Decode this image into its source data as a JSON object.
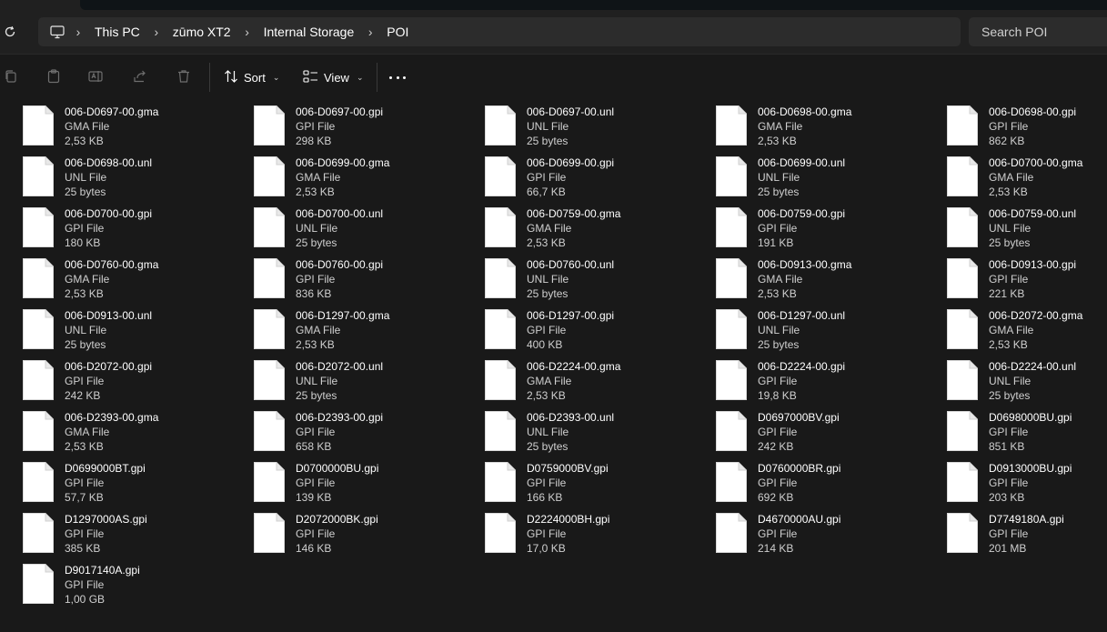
{
  "breadcrumb": [
    "This PC",
    "zūmo XT2",
    "Internal Storage",
    "POI"
  ],
  "search": {
    "placeholder": "Search POI"
  },
  "toolbar": {
    "sort_label": "Sort",
    "view_label": "View"
  },
  "files": [
    {
      "name": "006-D0697-00.gma",
      "type": "GMA File",
      "size": "2,53 KB"
    },
    {
      "name": "006-D0697-00.gpi",
      "type": "GPI File",
      "size": "298 KB"
    },
    {
      "name": "006-D0697-00.unl",
      "type": "UNL File",
      "size": "25 bytes"
    },
    {
      "name": "006-D0698-00.gma",
      "type": "GMA File",
      "size": "2,53 KB"
    },
    {
      "name": "006-D0698-00.gpi",
      "type": "GPI File",
      "size": "862 KB"
    },
    {
      "name": "006-D0698-00.unl",
      "type": "UNL File",
      "size": "25 bytes"
    },
    {
      "name": "006-D0699-00.gma",
      "type": "GMA File",
      "size": "2,53 KB"
    },
    {
      "name": "006-D0699-00.gpi",
      "type": "GPI File",
      "size": "66,7 KB"
    },
    {
      "name": "006-D0699-00.unl",
      "type": "UNL File",
      "size": "25 bytes"
    },
    {
      "name": "006-D0700-00.gma",
      "type": "GMA File",
      "size": "2,53 KB"
    },
    {
      "name": "006-D0700-00.gpi",
      "type": "GPI File",
      "size": "180 KB"
    },
    {
      "name": "006-D0700-00.unl",
      "type": "UNL File",
      "size": "25 bytes"
    },
    {
      "name": "006-D0759-00.gma",
      "type": "GMA File",
      "size": "2,53 KB"
    },
    {
      "name": "006-D0759-00.gpi",
      "type": "GPI File",
      "size": "191 KB"
    },
    {
      "name": "006-D0759-00.unl",
      "type": "UNL File",
      "size": "25 bytes"
    },
    {
      "name": "006-D0760-00.gma",
      "type": "GMA File",
      "size": "2,53 KB"
    },
    {
      "name": "006-D0760-00.gpi",
      "type": "GPI File",
      "size": "836 KB"
    },
    {
      "name": "006-D0760-00.unl",
      "type": "UNL File",
      "size": "25 bytes"
    },
    {
      "name": "006-D0913-00.gma",
      "type": "GMA File",
      "size": "2,53 KB"
    },
    {
      "name": "006-D0913-00.gpi",
      "type": "GPI File",
      "size": "221 KB"
    },
    {
      "name": "006-D0913-00.unl",
      "type": "UNL File",
      "size": "25 bytes"
    },
    {
      "name": "006-D1297-00.gma",
      "type": "GMA File",
      "size": "2,53 KB"
    },
    {
      "name": "006-D1297-00.gpi",
      "type": "GPI File",
      "size": "400 KB"
    },
    {
      "name": "006-D1297-00.unl",
      "type": "UNL File",
      "size": "25 bytes"
    },
    {
      "name": "006-D2072-00.gma",
      "type": "GMA File",
      "size": "2,53 KB"
    },
    {
      "name": "006-D2072-00.gpi",
      "type": "GPI File",
      "size": "242 KB"
    },
    {
      "name": "006-D2072-00.unl",
      "type": "UNL File",
      "size": "25 bytes"
    },
    {
      "name": "006-D2224-00.gma",
      "type": "GMA File",
      "size": "2,53 KB"
    },
    {
      "name": "006-D2224-00.gpi",
      "type": "GPI File",
      "size": "19,8 KB"
    },
    {
      "name": "006-D2224-00.unl",
      "type": "UNL File",
      "size": "25 bytes"
    },
    {
      "name": "006-D2393-00.gma",
      "type": "GMA File",
      "size": "2,53 KB"
    },
    {
      "name": "006-D2393-00.gpi",
      "type": "GPI File",
      "size": "658 KB"
    },
    {
      "name": "006-D2393-00.unl",
      "type": "UNL File",
      "size": "25 bytes"
    },
    {
      "name": "D0697000BV.gpi",
      "type": "GPI File",
      "size": "242 KB"
    },
    {
      "name": "D0698000BU.gpi",
      "type": "GPI File",
      "size": "851 KB"
    },
    {
      "name": "D0699000BT.gpi",
      "type": "GPI File",
      "size": "57,7 KB"
    },
    {
      "name": "D0700000BU.gpi",
      "type": "GPI File",
      "size": "139 KB"
    },
    {
      "name": "D0759000BV.gpi",
      "type": "GPI File",
      "size": "166 KB"
    },
    {
      "name": "D0760000BR.gpi",
      "type": "GPI File",
      "size": "692 KB"
    },
    {
      "name": "D0913000BU.gpi",
      "type": "GPI File",
      "size": "203 KB"
    },
    {
      "name": "D1297000AS.gpi",
      "type": "GPI File",
      "size": "385 KB"
    },
    {
      "name": "D2072000BK.gpi",
      "type": "GPI File",
      "size": "146 KB"
    },
    {
      "name": "D2224000BH.gpi",
      "type": "GPI File",
      "size": "17,0 KB"
    },
    {
      "name": "D4670000AU.gpi",
      "type": "GPI File",
      "size": "214 KB"
    },
    {
      "name": "D7749180A.gpi",
      "type": "GPI File",
      "size": "201 MB"
    },
    {
      "name": "D9017140A.gpi",
      "type": "GPI File",
      "size": "1,00 GB"
    }
  ]
}
